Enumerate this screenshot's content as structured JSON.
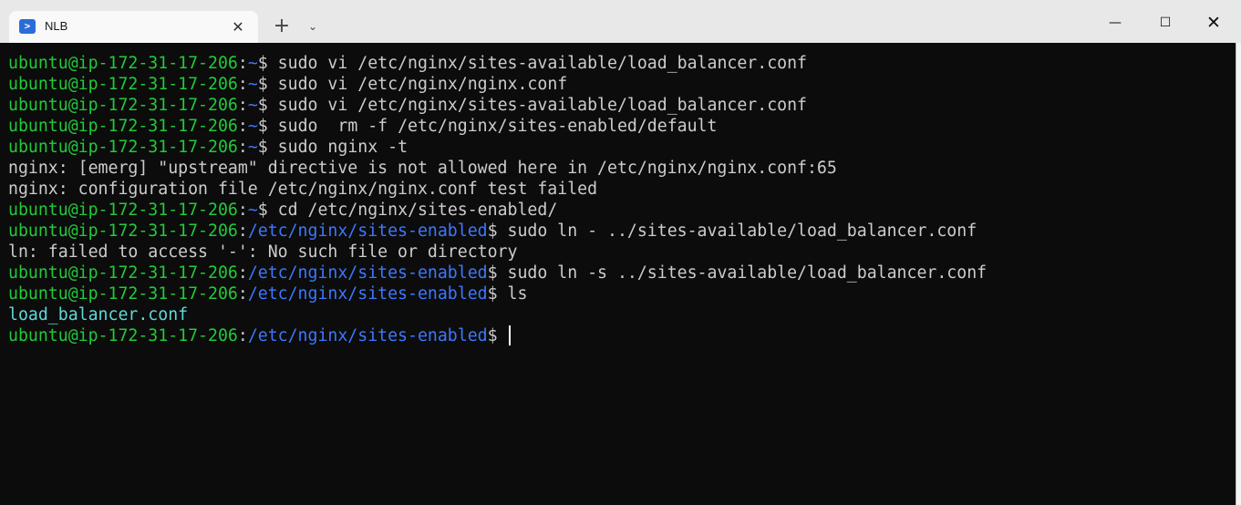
{
  "window": {
    "tab_title": "NLB",
    "tab_icon": "powershell-icon",
    "tab_close_glyph": "✕",
    "new_tab_glyph": "+",
    "dropdown_glyph": "⌄",
    "minimize_glyph": "—",
    "maximize_glyph": "☐",
    "close_glyph": "✕"
  },
  "colors": {
    "terminal_bg": "#0c0c0c",
    "prompt_user": "#22c93a",
    "prompt_path": "#3b78ff",
    "output": "#cccccc",
    "ls_file": "#61d6d6"
  },
  "terminal": {
    "lines": [
      {
        "user": "ubuntu@ip-172-31-17-206",
        "sep": ":",
        "path": "~",
        "sym": "$",
        "cmd": " sudo vi /etc/nginx/sites-available/load_balancer.conf"
      },
      {
        "user": "ubuntu@ip-172-31-17-206",
        "sep": ":",
        "path": "~",
        "sym": "$",
        "cmd": " sudo vi /etc/nginx/nginx.conf"
      },
      {
        "user": "ubuntu@ip-172-31-17-206",
        "sep": ":",
        "path": "~",
        "sym": "$",
        "cmd": " sudo vi /etc/nginx/sites-available/load_balancer.conf"
      },
      {
        "user": "ubuntu@ip-172-31-17-206",
        "sep": ":",
        "path": "~",
        "sym": "$",
        "cmd": " sudo  rm -f /etc/nginx/sites-enabled/default"
      },
      {
        "user": "ubuntu@ip-172-31-17-206",
        "sep": ":",
        "path": "~",
        "sym": "$",
        "cmd": " sudo nginx -t"
      },
      {
        "output": "nginx: [emerg] \"upstream\" directive is not allowed here in /etc/nginx/nginx.conf:65"
      },
      {
        "output": "nginx: configuration file /etc/nginx/nginx.conf test failed"
      },
      {
        "user": "ubuntu@ip-172-31-17-206",
        "sep": ":",
        "path": "~",
        "sym": "$",
        "cmd": " cd /etc/nginx/sites-enabled/"
      },
      {
        "user": "ubuntu@ip-172-31-17-206",
        "sep": ":",
        "path": "/etc/nginx/sites-enabled",
        "sym": "$",
        "cmd": " sudo ln - ../sites-available/load_balancer.conf"
      },
      {
        "output": "ln: failed to access '-': No such file or directory"
      },
      {
        "user": "ubuntu@ip-172-31-17-206",
        "sep": ":",
        "path": "/etc/nginx/sites-enabled",
        "sym": "$",
        "cmd": " sudo ln -s ../sites-available/load_balancer.conf"
      },
      {
        "user": "ubuntu@ip-172-31-17-206",
        "sep": ":",
        "path": "/etc/nginx/sites-enabled",
        "sym": "$",
        "cmd": " ls"
      },
      {
        "file": "load_balancer.conf"
      },
      {
        "user": "ubuntu@ip-172-31-17-206",
        "sep": ":",
        "path": "/etc/nginx/sites-enabled",
        "sym": "$",
        "cmd": "",
        "cursor": true
      }
    ]
  }
}
